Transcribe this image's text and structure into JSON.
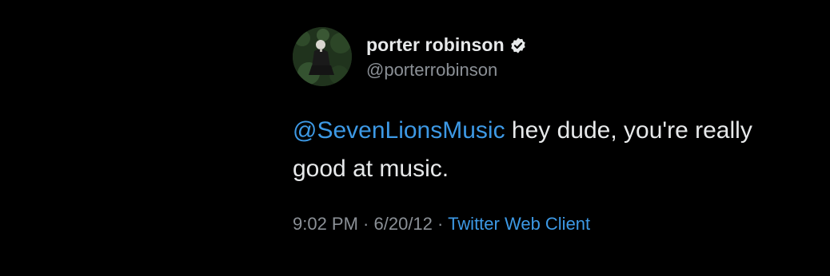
{
  "tweet": {
    "display_name": "porter robinson",
    "handle": "@porterrobinson",
    "verified_icon": "verified-badge-icon",
    "mention": "@SevenLionsMusic",
    "text_rest": " hey dude, you're really good at music.",
    "time": "9:02 PM",
    "sep1": " · ",
    "date": "6/20/12",
    "sep2": " · ",
    "client": "Twitter Web Client"
  },
  "colors": {
    "background": "#000000",
    "primary_text": "#e7e9ea",
    "secondary_text": "#8b9096",
    "link": "#3d99e5"
  }
}
